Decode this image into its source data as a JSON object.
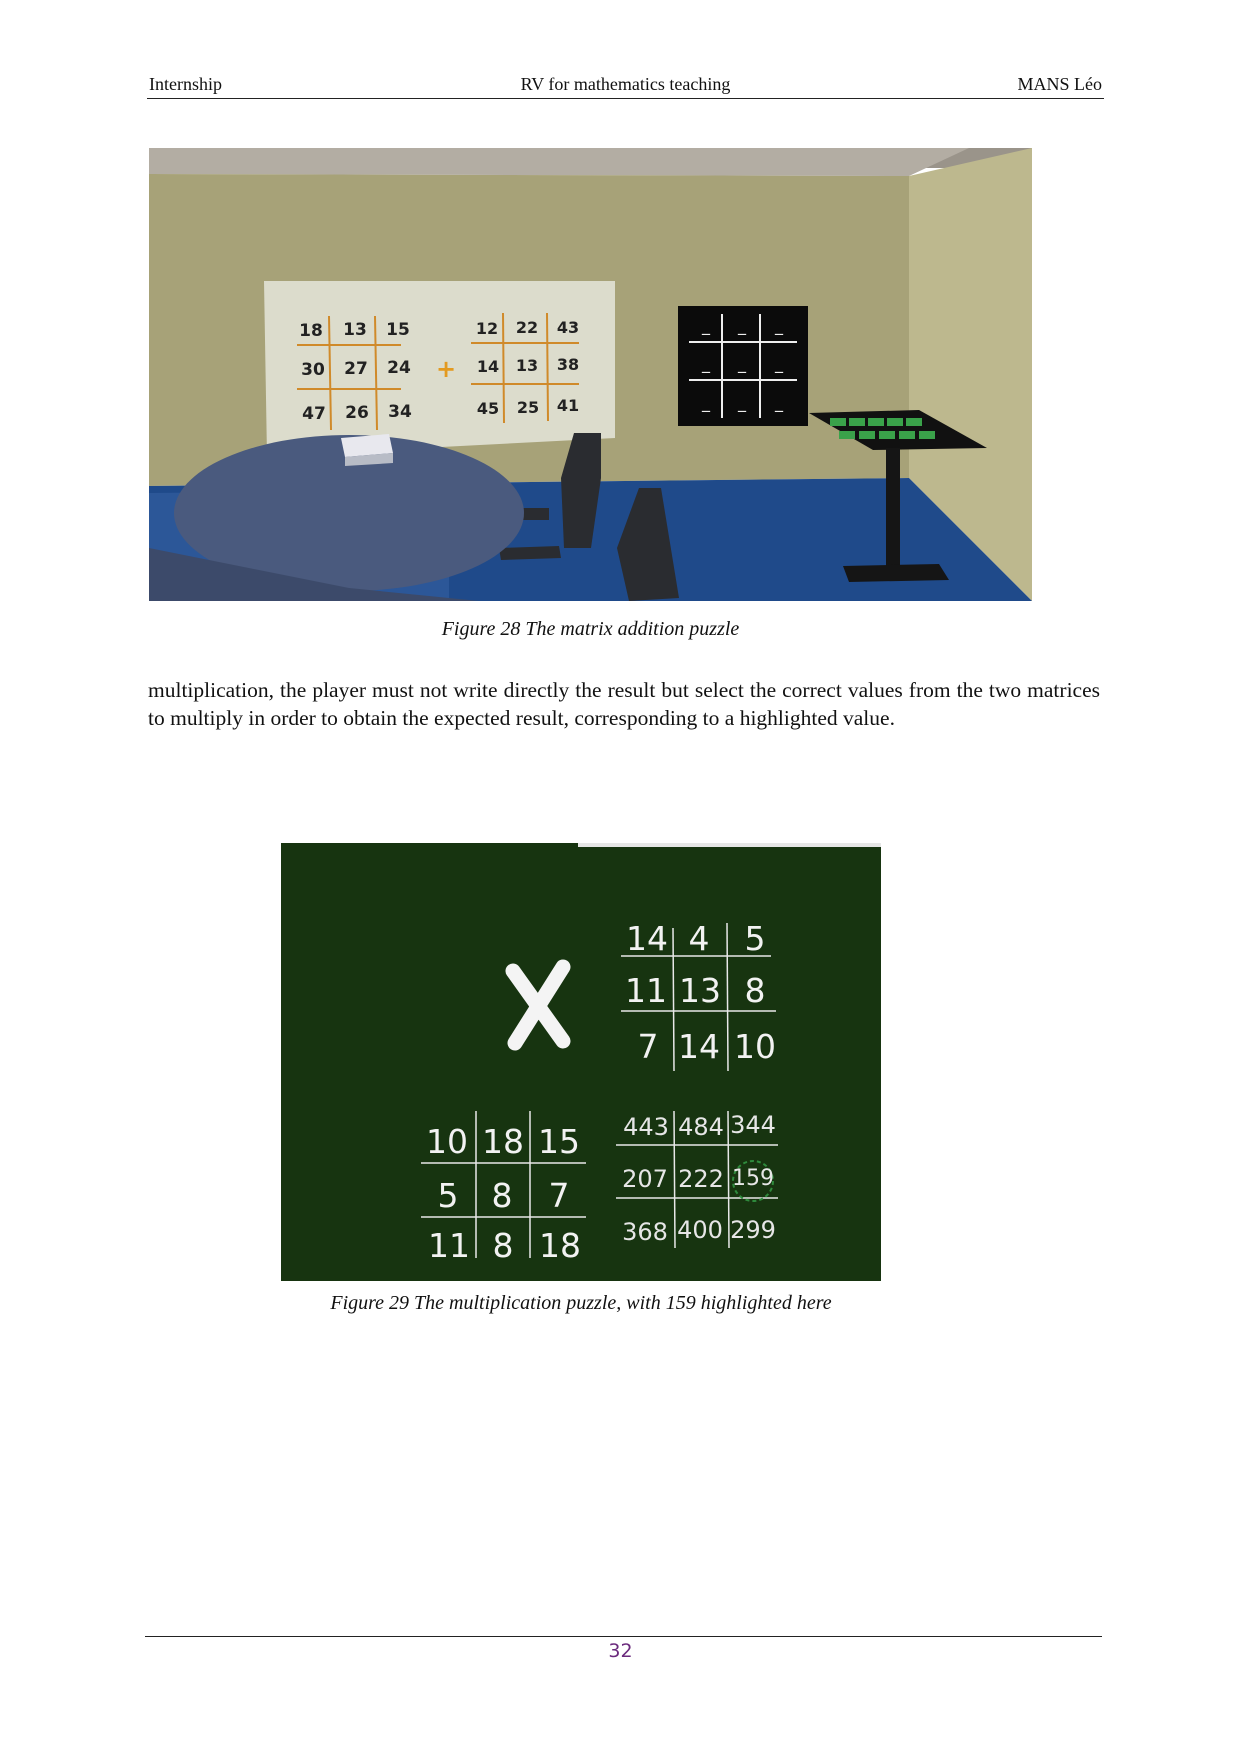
{
  "header": {
    "left": "Internship",
    "center": "RV for mathematics teaching",
    "right": "MANS Léo"
  },
  "figure28": {
    "caption": "Figure 28 The matrix addition puzzle",
    "matrix_a": [
      "18",
      "13",
      "15",
      "30",
      "27",
      "24",
      "47",
      "26",
      "34"
    ],
    "operator": "+",
    "matrix_b": [
      "12",
      "22",
      "43",
      "14",
      "13",
      "38",
      "45",
      "25",
      "41"
    ],
    "answer_board": [
      "_",
      "_",
      "_",
      "_",
      "_",
      "_",
      "_",
      "_",
      "_"
    ]
  },
  "body": {
    "paragraph": "multiplication, the player must not write  directly the result but select the correct values from the two matrices to multiply in order to obtain the expected result, corresponding to a highlighted value."
  },
  "figure29": {
    "caption": "Figure 29 The multiplication puzzle, with 159 highlighted here",
    "top_matrix": [
      "14",
      "4",
      "5",
      "11",
      "13",
      "8",
      "7",
      "14",
      "10"
    ],
    "left_matrix": [
      "10",
      "18",
      "15",
      "5",
      "8",
      "7",
      "11",
      "8",
      "18"
    ],
    "result_matrix": [
      "443",
      "484",
      "344",
      "207",
      "222",
      "159",
      "368",
      "400",
      "299"
    ],
    "highlighted": "159"
  },
  "footer": {
    "page_number": "32"
  }
}
